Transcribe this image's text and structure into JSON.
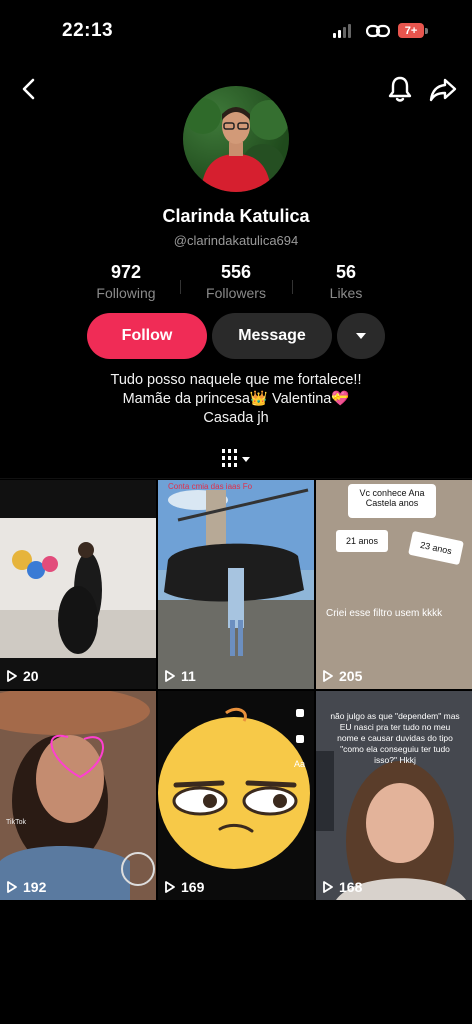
{
  "status_bar": {
    "time": "22:13",
    "battery": "7+"
  },
  "profile": {
    "name": "Clarinda Katulica",
    "handle": "@clarindakatulica694",
    "stats": [
      {
        "value": "972",
        "label": "Following"
      },
      {
        "value": "556",
        "label": "Followers"
      },
      {
        "value": "56",
        "label": "Likes"
      }
    ],
    "bio": [
      "Tudo posso naquele que me fortalece!!",
      "Mamãe da princesa👑 Valentina💝",
      "Casada jh"
    ]
  },
  "actions": {
    "follow": "Follow",
    "message": "Message"
  },
  "videos": [
    {
      "views": "20"
    },
    {
      "views": "11",
      "caption": "Conta cmia das iaas Fo"
    },
    {
      "views": "205",
      "question": "Vc conhece Ana Castela anos",
      "card_a": "21 anos",
      "card_b": "23 anos",
      "caption": "Criei esse filtro usem kkkk"
    },
    {
      "views": "192",
      "watermark": "TikTok"
    },
    {
      "views": "169",
      "side_label": "Aa"
    },
    {
      "views": "168",
      "caption": "não julgo as que \"dependem\" mas EU nasci pra ter tudo no meu nome e causar duvidas do tipo \"como ela conseguiu ter tudo isso?\" Hkkj"
    }
  ],
  "colors": {
    "follow": "#f02c56",
    "secondary_button": "#2a2a2a",
    "background": "#000000"
  }
}
